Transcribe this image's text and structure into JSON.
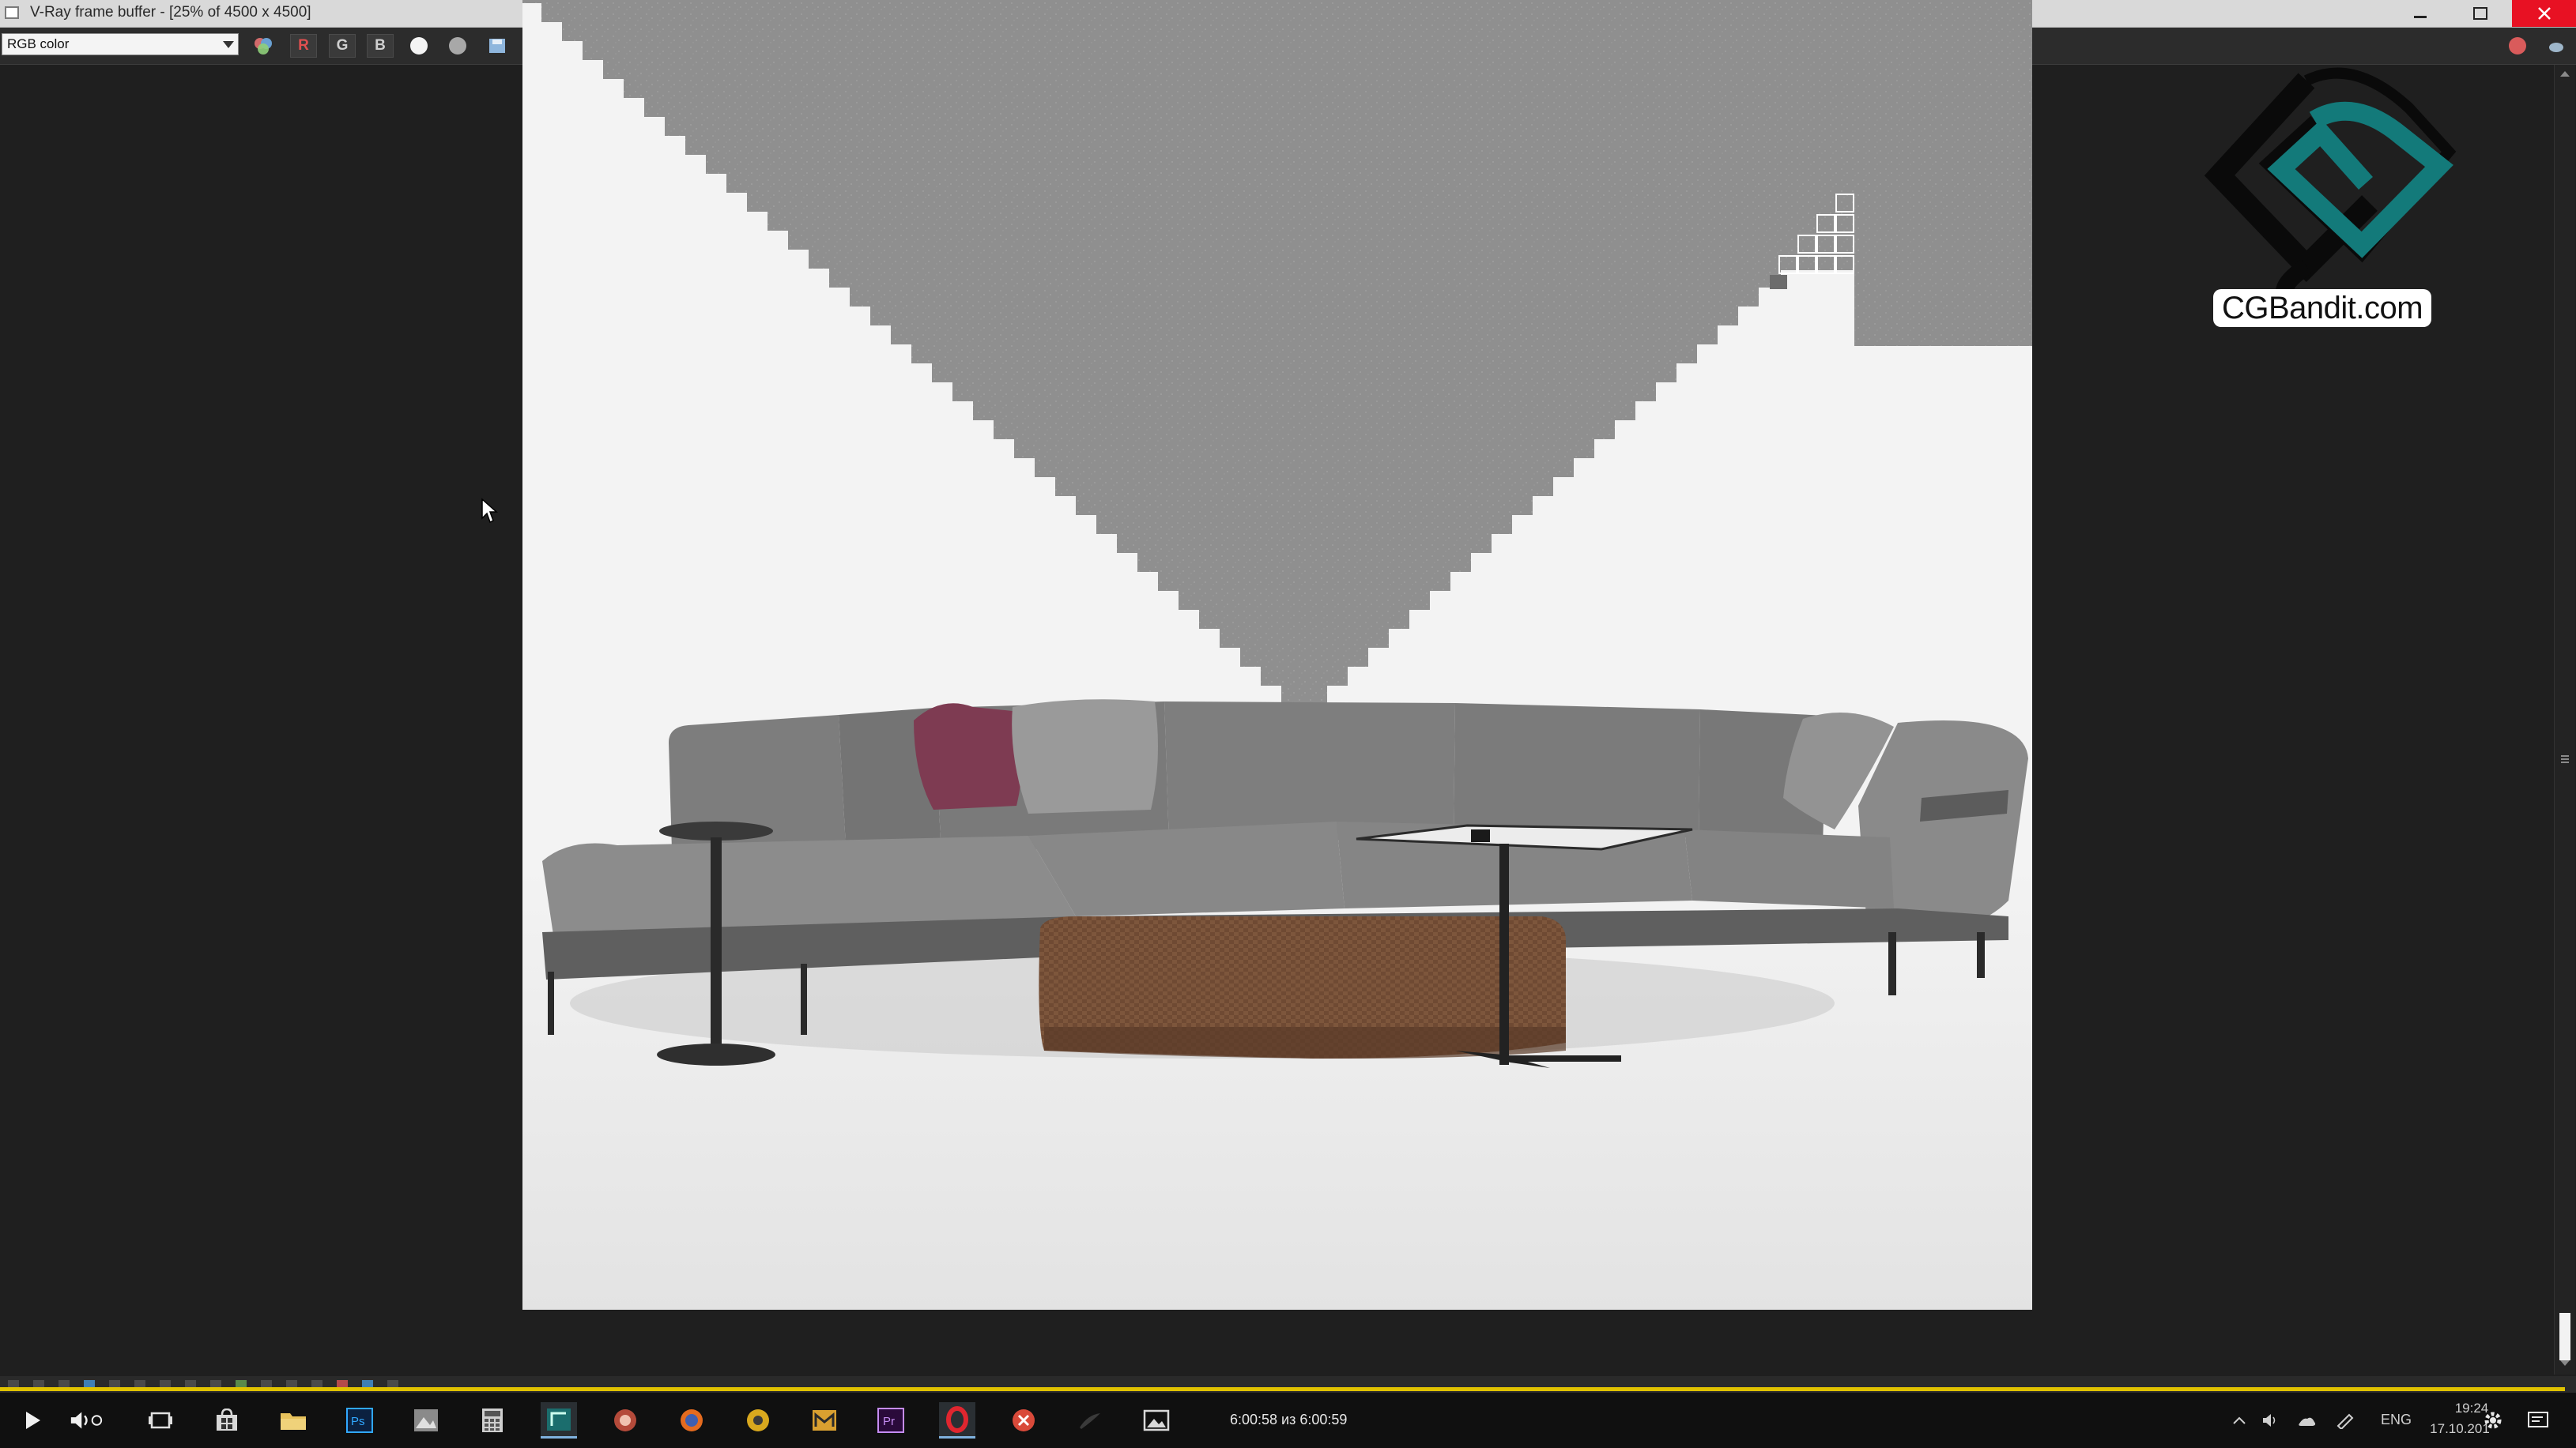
{
  "window": {
    "title": "V-Ray frame buffer - [25% of 4500 x 4500]"
  },
  "toolbar": {
    "channel_select": "RGB color",
    "channels": {
      "r": "R",
      "g": "G",
      "b": "B"
    },
    "icons": [
      "color-balls-icon",
      "channel-r-icon",
      "channel-g-icon",
      "channel-b-icon",
      "white-dot-icon",
      "grey-dot-icon",
      "save-image-icon",
      "load-image-icon",
      "clear-image-icon",
      "duplicate-to-history-icon",
      "track-mouse-icon",
      "region-render-icon",
      "link-to-vfb-icon",
      "show-corrections-icon",
      "pixel-info-icon"
    ]
  },
  "logo": {
    "text": "CGBandit.com",
    "colors": {
      "teal": "#137a7a",
      "black": "#0a0a0a"
    }
  },
  "taskbar": {
    "timecode": "6:00:58 из 6:00:59",
    "language": "ENG",
    "time": "19:24",
    "date": "17.10.201"
  },
  "colors": {
    "background": "#1f1f1f",
    "unrendered_bucket": "#8f8f8f",
    "progress": "#e0c200",
    "close_button": "#e81123"
  }
}
